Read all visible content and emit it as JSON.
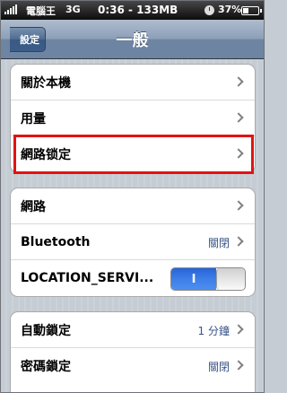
{
  "status_bar": {
    "carrier": "電腦王",
    "network": "3G",
    "time_memory": "0:36 - 133MB",
    "battery_text": "37%",
    "battery_level": 0.37
  },
  "nav": {
    "back_label": "設定",
    "title": "一般"
  },
  "group1": {
    "items": [
      {
        "label": "關於本機"
      },
      {
        "label": "用量"
      },
      {
        "label": "網路锁定"
      }
    ]
  },
  "group2": {
    "items": [
      {
        "label": "網路"
      },
      {
        "label": "Bluetooth",
        "value": "關閉"
      },
      {
        "label": "LOCATION_SERVI...",
        "toggle_text": "I",
        "toggle_on": true
      }
    ]
  },
  "group3": {
    "items": [
      {
        "label": "自動鎖定",
        "value": "1 分鐘"
      },
      {
        "label": "密碼鎖定",
        "value": "關閉"
      }
    ]
  },
  "colors": {
    "highlight": "#e01313",
    "value_text": "#385487",
    "toggle_blue": "#3d7ee8"
  }
}
